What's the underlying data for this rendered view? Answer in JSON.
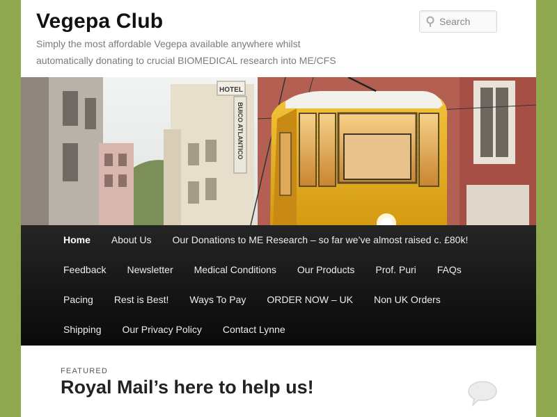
{
  "site": {
    "title": "Vegepa Club",
    "description": "Simply the most affordable Vegepa available anywhere whilst automatically donating to crucial BIOMEDICAL research into ME/CFS"
  },
  "search": {
    "placeholder": "Search"
  },
  "banner": {
    "sign_hotel": "HOTEL",
    "sign_name": "BUICO ATLANTICO"
  },
  "nav": {
    "items": [
      {
        "label": "Home",
        "active": true
      },
      {
        "label": "About Us"
      },
      {
        "label": "Our Donations to ME Research – so far we’ve almost raised c. £80k!"
      },
      {
        "label": "Feedback"
      },
      {
        "label": "Newsletter"
      },
      {
        "label": "Medical Conditions"
      },
      {
        "label": "Our Products"
      },
      {
        "label": "Prof. Puri"
      },
      {
        "label": "FAQs"
      },
      {
        "label": "Pacing"
      },
      {
        "label": "Rest is Best!"
      },
      {
        "label": "Ways To Pay"
      },
      {
        "label": "ORDER NOW – UK"
      },
      {
        "label": "Non UK Orders"
      },
      {
        "label": "Shipping"
      },
      {
        "label": "Our Privacy Policy"
      },
      {
        "label": "Contact Lynne"
      }
    ]
  },
  "post": {
    "featured_label": "FEATURED",
    "title": "Royal Mail’s here to help us!"
  },
  "colors": {
    "background": "#8fa84f",
    "nav_background": "#111111",
    "tram_yellow": "#e8b520"
  },
  "icons": {
    "search": "search-icon",
    "comment": "comment-bubble-icon"
  }
}
